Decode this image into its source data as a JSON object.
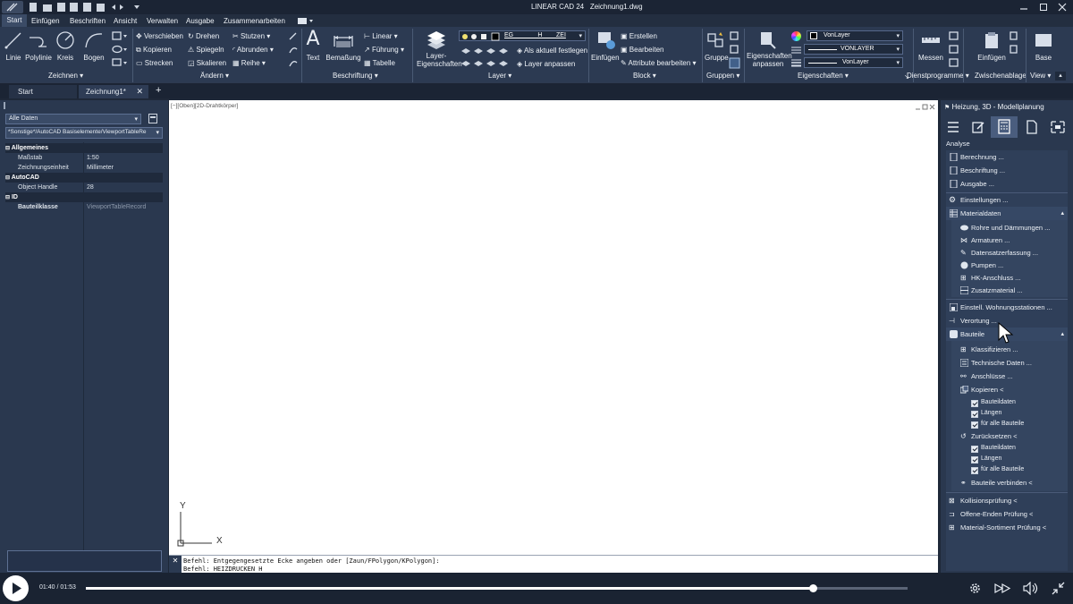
{
  "titlebar": {
    "app": "LINEAR CAD 24",
    "doc": "Zeichnung1.dwg",
    "workspace_icon": "cube-icon"
  },
  "menu": [
    "Start",
    "Einfügen",
    "Beschriften",
    "Ansicht",
    "Verwalten",
    "Ausgabe",
    "Zusammenarbeiten"
  ],
  "ribbon": {
    "zeichnen": {
      "label": "Zeichnen",
      "tools": [
        "Linie",
        "Polylinie",
        "Kreis",
        "Bogen"
      ]
    },
    "aendern": {
      "label": "Ändern",
      "items": [
        "Verschieben",
        "Drehen",
        "Stutzen",
        "Kopieren",
        "Spiegeln",
        "Abrunden",
        "Strecken",
        "Skalieren",
        "Reihe"
      ]
    },
    "beschriftung": {
      "label": "Beschriftung",
      "text": "Text",
      "bemassung": "Bemaßung",
      "linear": "Linear",
      "fuehrung": "Führung",
      "tabelle": "Tabelle"
    },
    "layer": {
      "label": "Layer",
      "big": "Layer-\nEigenschaften",
      "combo": "EG_______H____ZEI",
      "aktuell": "Als aktuell festlegen",
      "anpassen": "Layer anpassen"
    },
    "block": {
      "label": "Block",
      "einfuegen": "Einfügen",
      "erstellen": "Erstellen",
      "bearbeiten": "Bearbeiten",
      "attribute": "Attribute bearbeiten"
    },
    "gruppen": {
      "label": "Gruppen",
      "gruppe": "Gruppe"
    },
    "eigenschaften": {
      "label": "Eigenschaften",
      "anpassen": "Eigenschaften\nanpassen",
      "color": "VonLayer",
      "linetype": "VONLAYER",
      "lineweight": "VonLayer"
    },
    "dienst": {
      "label": "Dienstprogramme",
      "messen": "Messen"
    },
    "zwischen": {
      "label": "Zwischenablage",
      "einfuegen": "Einfügen"
    },
    "view": {
      "label": "View",
      "base": "Base"
    }
  },
  "doctabs": {
    "start": "Start",
    "active": "Zeichnung1*"
  },
  "props": {
    "filter": "Alle Daten",
    "path": "*Sonstige*/AutoCAD Basiselemente/ViewportTableRe",
    "sections": [
      {
        "title": "Allgemeines",
        "rows": [
          [
            "Maßstab",
            "1:50"
          ],
          [
            "Zeichnungseinheit",
            "Millimeter"
          ]
        ]
      },
      {
        "title": "AutoCAD",
        "rows": [
          [
            "Object Handle",
            "28"
          ]
        ]
      },
      {
        "title": "ID",
        "rows": [
          [
            "Bauteilklasse",
            "ViewportTableRecord"
          ]
        ]
      }
    ]
  },
  "viewport": {
    "label": "[−][Oben][2D-Drahtkörper]",
    "y_axis": "Y",
    "x_axis": "X"
  },
  "command": {
    "line1": "Befehl: Entgegengesetzte Ecke angeben oder [Zaun/FPolygon/KPolygon]:",
    "line2": "Befehl: HEIZDRUCKEN H"
  },
  "palette": {
    "title": "Heizung, 3D - Modellplanung",
    "section": "Analyse",
    "items_top": [
      "Berechnung ...",
      "Beschriftung ...",
      "Ausgabe ...",
      "Einstellungen ...",
      "Materialdaten"
    ],
    "material_items": [
      "Rohre und Dämmungen ...",
      "Armaturen ...",
      "Datensatzerfassung ...",
      "Pumpen ...",
      "HK-Anschluss ...",
      "Zusatzmaterial ..."
    ],
    "items_mid": [
      "Einstell. Wohnungsstationen ...",
      "Verortung ...",
      "Bauteile"
    ],
    "bauteile_items": [
      "Klassifizieren ...",
      "Technische Daten ...",
      "Anschlüsse ...",
      "Kopieren <"
    ],
    "kopieren_checks": [
      "Bauteildaten",
      "Längen",
      "für alle Bauteile"
    ],
    "zurueck": "Zurücksetzen <",
    "zurueck_checks": [
      "Bauteildaten",
      "Längen",
      "für alle Bauteile"
    ],
    "verbinden": "Bauteile verbinden <",
    "items_bottom": [
      "Kollisionsprüfung <",
      "Offene-Enden Prüfung <",
      "Material-Sortiment Prüfung <"
    ]
  },
  "player": {
    "time": "01:40 / 01:53",
    "progress": 0.885
  }
}
